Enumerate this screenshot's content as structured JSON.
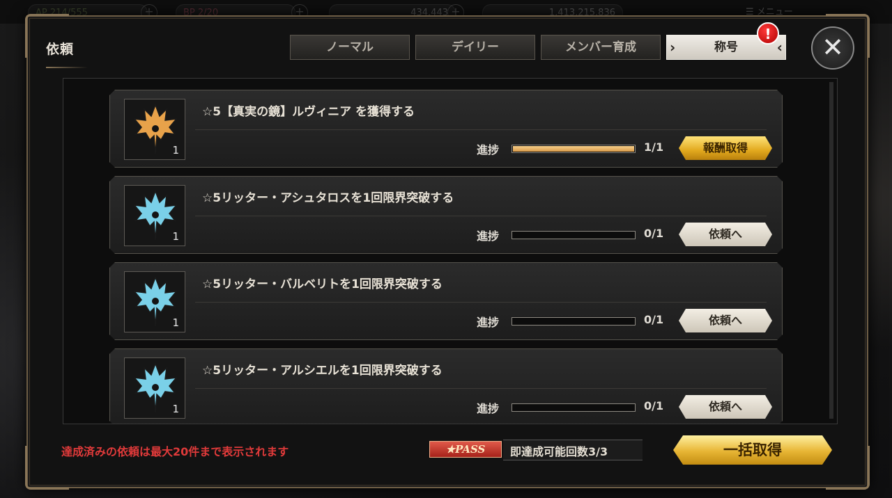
{
  "topbar": {
    "ap": "214/555",
    "bp": "2/20",
    "gold": "434,443",
    "coins": "1,413,215,836",
    "menu": "メニュー"
  },
  "panel": {
    "title": "依頼",
    "tabs": [
      {
        "label": "ノーマル",
        "active": false
      },
      {
        "label": "デイリー",
        "active": false
      },
      {
        "label": "メンバー育成",
        "active": false
      },
      {
        "label": "称号",
        "active": true
      }
    ],
    "alert_icon": "exclamation-icon",
    "close_icon": "close-icon"
  },
  "requests": [
    {
      "title": "☆5【真実の鏡】ルヴィニア を獲得する",
      "icon_color": "#e8a24a",
      "count": "1",
      "progress_label": "進捗",
      "progress_value": 1.0,
      "progress_text": "1/1",
      "button": "報酬取得",
      "button_style": "gold"
    },
    {
      "title": "☆5リッター・アシュタロスを1回限界突破する",
      "icon_color": "#7ad0e8",
      "count": "1",
      "progress_label": "進捗",
      "progress_value": 0.0,
      "progress_text": "0/1",
      "button": "依頼へ",
      "button_style": "plain"
    },
    {
      "title": "☆5リッター・バルベリトを1回限界突破する",
      "icon_color": "#7ad0e8",
      "count": "1",
      "progress_label": "進捗",
      "progress_value": 0.0,
      "progress_text": "0/1",
      "button": "依頼へ",
      "button_style": "plain"
    },
    {
      "title": "☆5リッター・アルシエルを1回限界突破する",
      "icon_color": "#7ad0e8",
      "count": "1",
      "progress_label": "進捗",
      "progress_value": 0.0,
      "progress_text": "0/1",
      "button": "依頼へ",
      "button_style": "plain"
    }
  ],
  "footer": {
    "note": "達成済みの依頼は最大20件まで表示されます",
    "pass_badge": "PASS",
    "pass_text": "即達成可能回数3/3",
    "bulk_button": "一括取得"
  }
}
